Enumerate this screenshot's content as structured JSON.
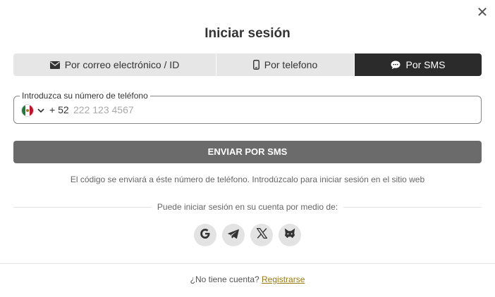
{
  "modal": {
    "title": "Iniciar sesión",
    "close_icon": "close-icon"
  },
  "tabs": [
    {
      "label": "Por correo electrónico / ID",
      "icon": "envelope-icon",
      "active": false
    },
    {
      "label": "Por telefono",
      "icon": "mobile-phone-icon",
      "active": false
    },
    {
      "label": "Por SMS",
      "icon": "chat-bubble-icon",
      "active": true
    }
  ],
  "phone": {
    "legend": "Introduzca su número de teléfono",
    "country_flag": "mexico-flag-icon",
    "dial_code": "+ 52",
    "value": "",
    "placeholder": "222 123 4567"
  },
  "send_button": {
    "label": "ENVIAR POR SMS"
  },
  "hint": "El código se enviará a éste número de teléfono. Introdúzcalo para iniciar sesión en el sitio web",
  "social": {
    "label": "Puede iniciar sesión en su cuenta por medio de:",
    "providers": [
      "google-icon",
      "telegram-icon",
      "x-icon",
      "metamask-icon"
    ]
  },
  "footer": {
    "prompt": "¿No tiene cuenta?",
    "register_link": "Registrarse"
  },
  "colors": {
    "tab_active_bg": "#2b2b2b",
    "tab_inactive_bg": "#e6e6e6",
    "send_button_bg": "#6b6b6b",
    "link": "#9a7a10",
    "social_bg": "#e3e3e3"
  }
}
